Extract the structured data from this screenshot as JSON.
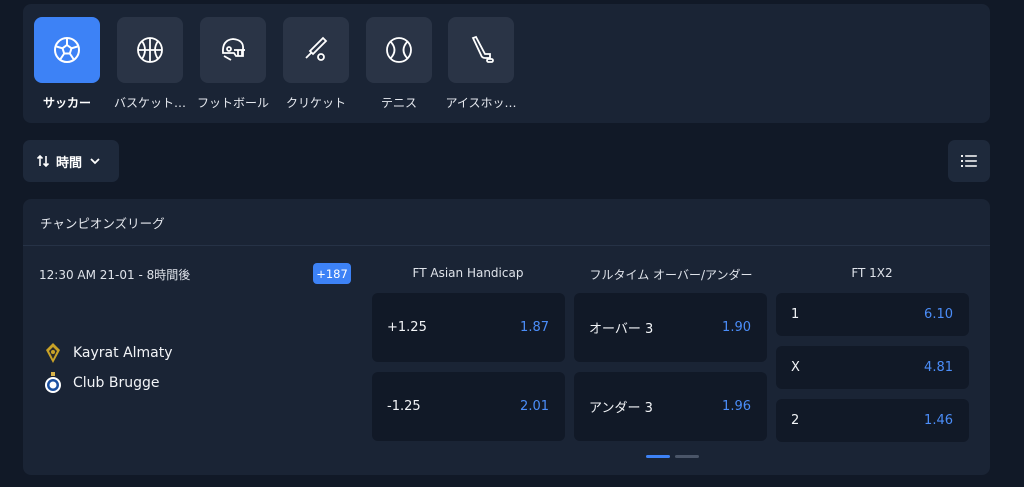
{
  "sports": [
    {
      "label": "サッカー",
      "icon": "soccer-ball-icon",
      "active": true
    },
    {
      "label": "バスケット…",
      "icon": "basketball-icon",
      "active": false
    },
    {
      "label": "フットボール",
      "icon": "football-helmet-icon",
      "active": false
    },
    {
      "label": "クリケット",
      "icon": "cricket-bat-icon",
      "active": false
    },
    {
      "label": "テニス",
      "icon": "tennis-ball-icon",
      "active": false
    },
    {
      "label": "アイスホッ…",
      "icon": "hockey-stick-icon",
      "active": false
    }
  ],
  "sort": {
    "label": "時間",
    "icon": "sort-arrows-icon",
    "chevron": "chevron-down-icon"
  },
  "view_toggle": {
    "icon": "list-view-icon"
  },
  "league": {
    "name": "チャンピオンズリーグ",
    "match": {
      "time": "12:30 AM 21-01 - 8時間後",
      "more_markets": "+187",
      "home": {
        "name": "Kayrat Almaty",
        "crest": "kayrat-crest-icon"
      },
      "away": {
        "name": "Club Brugge",
        "crest": "brugge-crest-icon"
      },
      "markets": [
        {
          "title": "FT Asian Handicap",
          "outcomes": [
            {
              "name": "+1.25",
              "price": "1.87"
            },
            {
              "name": "-1.25",
              "price": "2.01"
            }
          ]
        },
        {
          "title": "フルタイム オーバー/アンダー",
          "outcomes": [
            {
              "name": "オーバー 3",
              "price": "1.90"
            },
            {
              "name": "アンダー 3",
              "price": "1.96"
            }
          ]
        },
        {
          "title": "FT 1X2",
          "outcomes": [
            {
              "name": "1",
              "price": "6.10"
            },
            {
              "name": "X",
              "price": "4.81"
            },
            {
              "name": "2",
              "price": "1.46"
            }
          ]
        }
      ]
    }
  },
  "colors": {
    "accent": "#3d82f6",
    "price": "#4b8df8",
    "card": "#1a2435",
    "background": "#111927"
  }
}
